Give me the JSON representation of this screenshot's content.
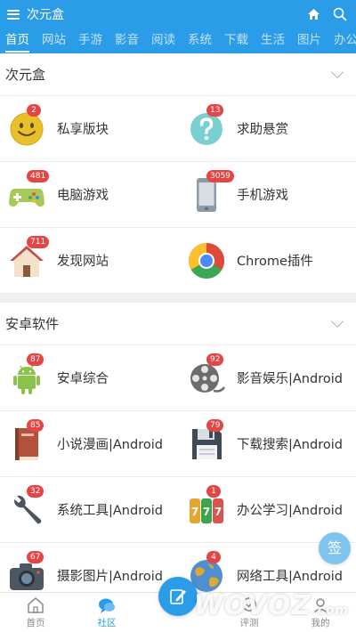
{
  "header": {
    "title": "次元盒",
    "tabs": [
      "首页",
      "网站",
      "手游",
      "影音",
      "阅读",
      "系统",
      "下载",
      "生活",
      "图片",
      "办公"
    ],
    "active_tab": 0
  },
  "sections": [
    {
      "title": "次元盒",
      "items": [
        {
          "label": "私享版块",
          "badge": "2",
          "icon": "smiley-icon"
        },
        {
          "label": "求助悬赏",
          "badge": "13",
          "icon": "question-icon"
        },
        {
          "label": "电脑游戏",
          "badge": "481",
          "icon": "gamepad-icon"
        },
        {
          "label": "手机游戏",
          "badge": "3059",
          "icon": "phone-icon"
        },
        {
          "label": "发现网站",
          "badge": "711",
          "icon": "house-icon"
        },
        {
          "label": "Chrome插件",
          "badge": "",
          "icon": "chrome-icon"
        }
      ]
    },
    {
      "title": "安卓软件",
      "items": [
        {
          "label": "安卓综合",
          "badge": "87",
          "icon": "android-icon"
        },
        {
          "label": "影音娱乐|Android",
          "badge": "92",
          "icon": "film-reel-icon"
        },
        {
          "label": "小说漫画|Android",
          "badge": "85",
          "icon": "book-icon"
        },
        {
          "label": "下载搜索|Android",
          "badge": "79",
          "icon": "floppy-disk-icon"
        },
        {
          "label": "系统工具|Android",
          "badge": "32",
          "icon": "wrench-icon"
        },
        {
          "label": "办公学习|Android",
          "badge": "1",
          "icon": "slot-machine-icon"
        },
        {
          "label": "摄影图片|Android",
          "badge": "67",
          "icon": "camera-icon"
        },
        {
          "label": "网络工具|Android",
          "badge": "4",
          "icon": "globe-icon"
        }
      ]
    }
  ],
  "sign_label": "签",
  "bottom_nav": [
    {
      "label": "首页",
      "icon": "home-icon"
    },
    {
      "label": "社区",
      "icon": "chat-bubble-icon"
    },
    {
      "label": "",
      "icon": "compose-icon"
    },
    {
      "label": "评测",
      "icon": "review-icon"
    },
    {
      "label": "我的",
      "icon": "user-icon"
    }
  ],
  "watermark": {
    "text": "WOVOZ",
    "suffix": ".com"
  },
  "colors": {
    "accent": "#2b9ce8",
    "badge": "#e64545"
  }
}
